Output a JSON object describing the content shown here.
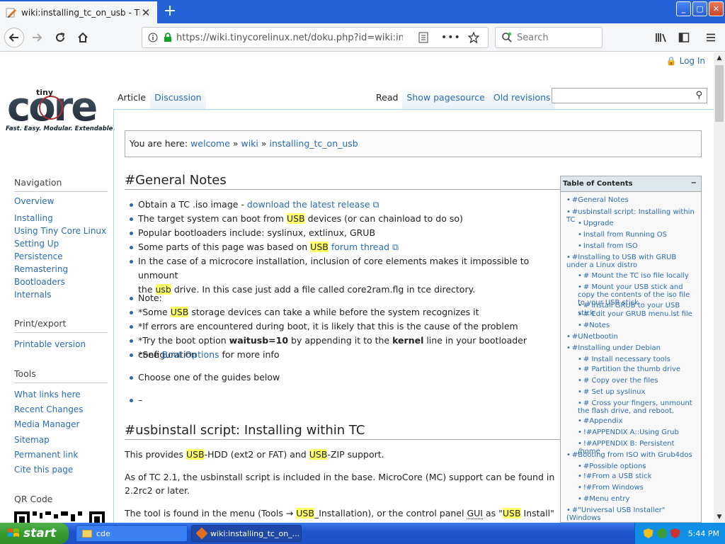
{
  "browser": {
    "tab_title": "wiki:installing_tc_on_usb - Tiny Co",
    "tab_close": "✕",
    "new_tab": "+",
    "url": "https://wiki.tinycorelinux.net/doku.php?id=wiki:install",
    "search_placeholder": "Search"
  },
  "page": {
    "login": "Log In",
    "logo_caption": "Fast. Easy. Modular. Extendable.",
    "tabs_left": [
      "Article",
      "Discussion"
    ],
    "tabs_right": [
      "Read",
      "Show pagesource",
      "Old revisions"
    ],
    "breadcrumb": {
      "prefix": "You are here:",
      "items": [
        "welcome",
        "wiki",
        "installing_tc_on_usb"
      ],
      "sep": "»"
    }
  },
  "sidebar": {
    "navigation_title": "Navigation",
    "navigation": [
      "Overview",
      "Installing",
      "Using Tiny Core Linux",
      "Setting Up",
      "Persistence",
      "Remastering",
      "Bootloaders",
      "Internals"
    ],
    "print_title": "Print/export",
    "print": [
      "Printable version"
    ],
    "tools_title": "Tools",
    "tools": [
      "What links here",
      "Recent Changes",
      "Media Manager",
      "Sitemap",
      "Permanent link",
      "Cite this page"
    ],
    "qr_title": "QR Code"
  },
  "content": {
    "h_general": "#General Notes",
    "g1_pre": "Obtain a TC .iso image - ",
    "g1_link": "download the latest release",
    "g2_pre": "The target system can boot from ",
    "g2_hl": "USB",
    "g2_post": " devices (or can chainload to do so)",
    "g3": "Popular bootloaders include: syslinux, extlinux, GRUB",
    "g4_pre": "Some parts of this page was based on ",
    "g4_hl": "USB",
    "g4_link": "forum thread",
    "g5_a": "In the case of a microcore installation, inclusion of core elements makes it impossible to unmount",
    "g5_b_pre": "the ",
    "g5_b_hl": "usb",
    "g5_b_post": " drive. In this case just add a file called core2ram.flg in tce directory.",
    "note": "Note:",
    "n1_pre": "*Some ",
    "n1_hl": "USB",
    "n1_post": " storage devices can take a while before the system recognizes it",
    "n2": "*If errors are encountered during boot, it is likely that this is the cause of the problem",
    "n3_pre": "*Try the boot option ",
    "n3_b1": "waitusb=10",
    "n3_mid": " by appending it to the ",
    "n3_b2": "kernel",
    "n3_post": " line in your bootloader configuration",
    "n4_pre": "*See ",
    "n4_link": "Boot Options",
    "n4_post": " for more info",
    "choose": "Choose one of the guides below",
    "dash": "–",
    "h_usbinstall": "#usbinstall script: Installing within TC",
    "p1_a": "This provides ",
    "p1_hl1": "USB",
    "p1_b": "-HDD (ext2 or FAT) and ",
    "p1_hl2": "USB",
    "p1_c": "-ZIP support.",
    "p2": "As of TC 2.1, the usbinstall script is included in the base. MicroCore (MC) support can be found in 2.2rc2 or later.",
    "p3_a": "The tool is found in the menu (Tools → ",
    "p3_hl1": "USB",
    "p3_b": "_Installation), or the control panel ",
    "p3_gui": "GUI",
    "p3_c": " as \"",
    "p3_hl2": "USB",
    "p3_d": " Install\""
  },
  "toc": {
    "title": "Table of Contents",
    "toggle": "−",
    "items": [
      {
        "level": 1,
        "text": "#General Notes"
      },
      {
        "level": 1,
        "text": "#usbinstall script: Installing within TC"
      },
      {
        "level": 2,
        "text": "Upgrade"
      },
      {
        "level": 2,
        "text": "Install from Running OS"
      },
      {
        "level": 2,
        "text": "Install from ISO"
      },
      {
        "level": 1,
        "text": "#Installing to USB with GRUB under a Linux distro"
      },
      {
        "level": 2,
        "text": "# Mount the TC iso file locally"
      },
      {
        "level": 2,
        "text": "# Mount your USB stick and copy the contents of the iso file to your USB stick"
      },
      {
        "level": 2,
        "text": "# Install GRUB to your USB stick"
      },
      {
        "level": 2,
        "text": "# Edit your GRUB menu.lst file"
      },
      {
        "level": 2,
        "text": "#Notes"
      },
      {
        "level": 1,
        "text": "#UNetbootin"
      },
      {
        "level": 1,
        "text": "#Installing under Debian"
      },
      {
        "level": 2,
        "text": "# Install necessary tools"
      },
      {
        "level": 2,
        "text": "# Partition the thumb drive"
      },
      {
        "level": 2,
        "text": "# Copy over the files"
      },
      {
        "level": 2,
        "text": "# Set up syslinux"
      },
      {
        "level": 2,
        "text": "# Cross your fingers, unmount the flash drive, and reboot."
      },
      {
        "level": 2,
        "text": "#Appendix"
      },
      {
        "level": 2,
        "text": "!#APPENDIX A::Using Grub"
      },
      {
        "level": 2,
        "text": "!#APPENDIX B: Persistent /home"
      },
      {
        "level": 1,
        "text": "#Booting from ISO with Grub4dos"
      },
      {
        "level": 2,
        "text": "#Possible options"
      },
      {
        "level": 2,
        "text": "!#From a USB stick"
      },
      {
        "level": 2,
        "text": "!#From Windows"
      },
      {
        "level": 2,
        "text": "#Menu entry"
      },
      {
        "level": 1,
        "text": "#\"Universal USB Installer\" (Windows"
      }
    ]
  },
  "taskbar": {
    "start": "start",
    "tasks": [
      "cde",
      "wiki:installing_tc_on_..."
    ],
    "clock": "5:44 PM"
  }
}
